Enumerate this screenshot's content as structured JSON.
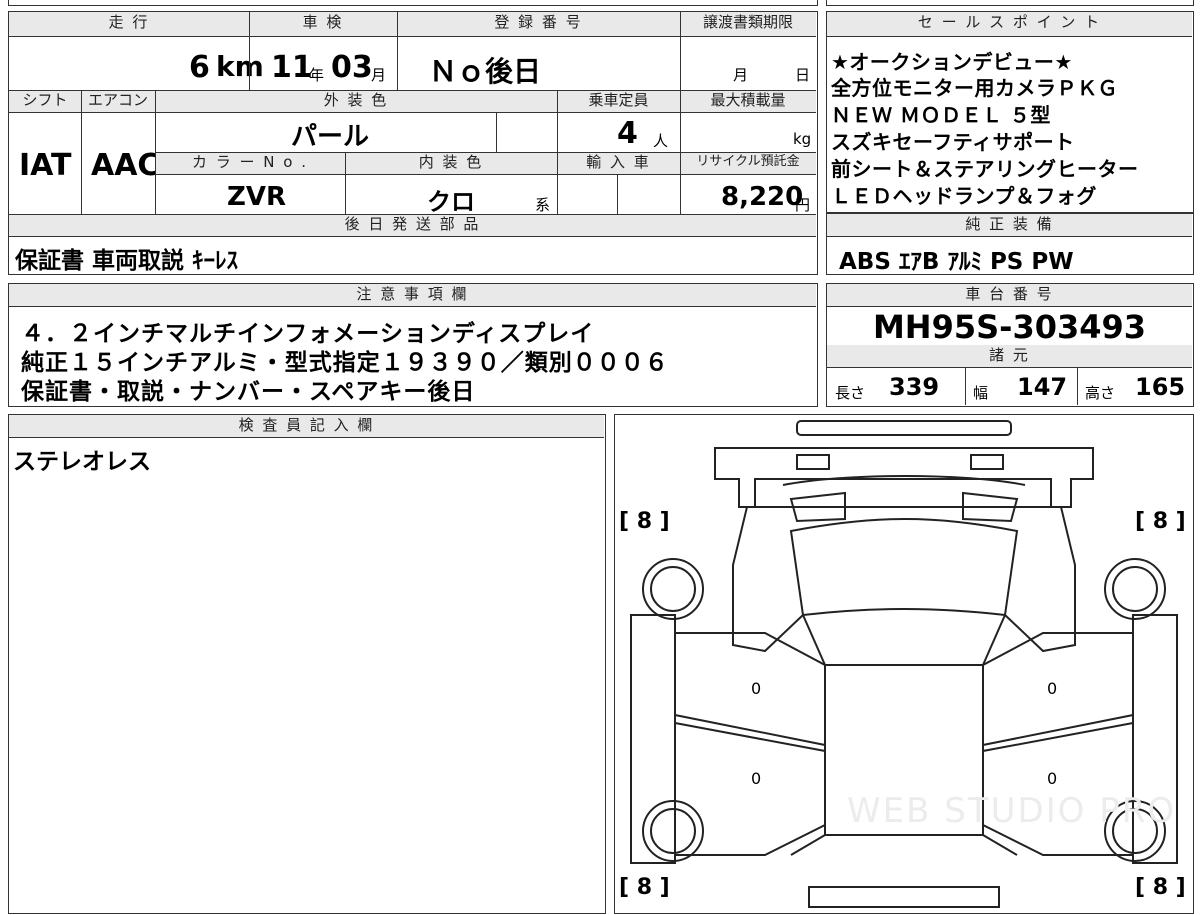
{
  "main": {
    "headers": {
      "mileage": "走 行",
      "inspection": "車 検",
      "registration": "登 録 番 号",
      "transfer_deadline": "譲渡書類期限",
      "shift": "シフト",
      "aircon": "エアコン",
      "exterior_color": "外 装 色",
      "capacity": "乗車定員",
      "max_load": "最大積載量",
      "color_no": "カ ラ ー N o .",
      "interior_color": "内 装 色",
      "import": "輸 入 車",
      "recycle": "リサイクル預託金",
      "later_parts": "後 日 発 送 部 品"
    },
    "mileage_value": "6",
    "mileage_unit": "km",
    "inspection_year": "11",
    "inspection_year_unit": "年",
    "inspection_month": "03",
    "inspection_month_unit": "月",
    "registration_value": "Ｎｏ後日",
    "transfer_month": "月",
    "transfer_day": "日",
    "shift_value": "IAT",
    "aircon_value": "AAC",
    "exterior_color_value": "パール",
    "capacity_value": "4",
    "capacity_unit": "人",
    "max_load_unit": "kg",
    "color_no_value": "ZVR",
    "interior_color_value": "クロ",
    "interior_color_suffix": "系",
    "recycle_value": "8,220",
    "recycle_unit": "円",
    "later_parts_value": "保証書  車両取説  ｷｰﾚｽ"
  },
  "sales_points": {
    "header": "セ ー ル ス ポ イ ン ト",
    "lines": [
      "★オークションデビュー★",
      "全方位モニター用カメラＰＫＧ",
      "ＮＥＷ  ＭＯＤＥＬ  ５型",
      "スズキセーフティサポート",
      "前シート＆ステアリングヒーター",
      "ＬＥＤヘッドランプ＆フォグ"
    ]
  },
  "equipment": {
    "header": "純 正 装 備",
    "value": "ABS  ｴｱB  ｱﾙﾐ  PS  PW"
  },
  "notes": {
    "header": "注 意 事 項 欄",
    "lines": [
      "４．２インチマルチインフォメーションディスプレイ",
      "純正１５インチアルミ・型式指定１９３９０／類別０００６",
      "保証書・取説・ナンバー・スペアキー後日"
    ]
  },
  "chassis": {
    "header": "車 台 番 号",
    "value": "MH95S-303493"
  },
  "specs": {
    "header": "諸 元",
    "length_label": "長さ",
    "length_value": "339",
    "width_label": "幅",
    "width_value": "147",
    "height_label": "高さ",
    "height_value": "165"
  },
  "inspector": {
    "header": "検 査 員 記 入 欄",
    "text": "ステレオレス"
  },
  "diagram": {
    "tire_tl": "[ 8 ]",
    "tire_tr": "[ 8 ]",
    "tire_bl": "[ 8 ]",
    "tire_br": "[ 8 ]",
    "mark_lf": "0",
    "mark_rf": "0",
    "mark_lr": "0",
    "mark_rr": "0",
    "watermark": "WEB STUDIO PRO"
  }
}
